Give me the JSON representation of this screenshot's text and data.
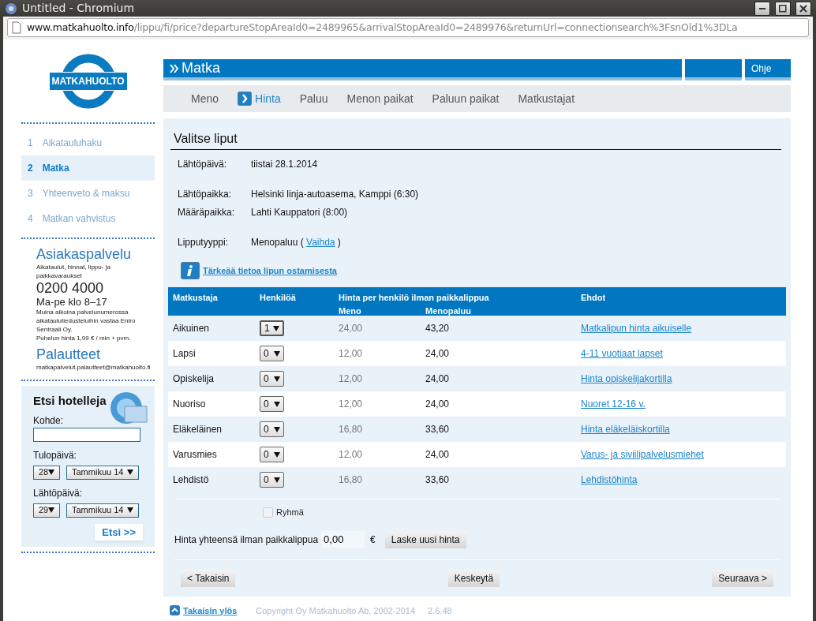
{
  "window": {
    "title": "Untitled - Chromium"
  },
  "address_bar": {
    "host": "www.matkahuolto.info",
    "path": "/lippu/fi/price?departureStopAreaId0=2489965&arrivalStopAreaId0=2489976&returnUrl=connectionsearch%3FsnOld1%3DLa"
  },
  "logo": {
    "text": "MATKAHUOLTO"
  },
  "header": {
    "title": "Matka",
    "help": "Ohje"
  },
  "phase_tabs": [
    {
      "label": "Meno",
      "selected": false
    },
    {
      "label": "Hinta",
      "selected": true
    },
    {
      "label": "Paluu",
      "selected": false
    },
    {
      "label": "Menon paikat",
      "selected": false
    },
    {
      "label": "Paluun paikat",
      "selected": false
    },
    {
      "label": "Matkustajat",
      "selected": false
    }
  ],
  "sidebar": {
    "steps": [
      {
        "number": "1",
        "label": "Aikatauluhaku",
        "selected": false
      },
      {
        "number": "2",
        "label": "Matka",
        "selected": true
      },
      {
        "number": "3",
        "label": "Yhteenveto & maksu",
        "selected": false
      },
      {
        "number": "4",
        "label": "Matkan vahvistus",
        "selected": false
      }
    ],
    "customer_service": {
      "title": "Asiakaspalvelu",
      "subtitle": "Aikataulut, hinnat, lippu- ja paikkavaraukset",
      "phone": "0200 4000",
      "hours": "Ma-pe klo 8–17",
      "note": "Muina aikoina palvelunumerossa aikataulutiedusteluihin vastaa Eniro Sentraali Oy.",
      "price": "Puhelun hinta 1,99 € / min + pvm.",
      "feedback_title": "Palautteet",
      "email": "matkapalvelut.palautteet@matkahuolto.fi"
    },
    "hotel_search": {
      "title": "Etsi hotelleja",
      "destination_label": "Kohde:",
      "arrival_label": "Tulopäivä:",
      "arrival_day": "28",
      "arrival_month": "Tammikuu 14",
      "departure_label": "Lähtöpäivä:",
      "departure_day": "29",
      "departure_month": "Tammikuu 14",
      "button": "Etsi >>"
    }
  },
  "main": {
    "heading": "Valitse liput",
    "detail_groups": [
      [
        {
          "label": "Lähtöpäivä:",
          "value": "tiistai 28.1.2014"
        }
      ],
      [
        {
          "label": "Lähtöpaikka:",
          "value": "Helsinki linja-autoasema, Kamppi (6:30)"
        },
        {
          "label": "Määräpaikka:",
          "value": "Lahti Kauppatori (8:00)"
        }
      ],
      [
        {
          "label": "Lipputyyppi:",
          "value": "Menopaluu (",
          "link": "Vaihda",
          "after": ")"
        }
      ]
    ],
    "info_link": "Tärkeää tietoa lipun ostamisesta",
    "table": {
      "columns": [
        "Matkustaja",
        "Henkilöä",
        "Hinta per henkilö ilman paikkalippua",
        "Ehdot"
      ],
      "subcolumns": [
        "Meno",
        "Menopaluu"
      ],
      "rows": [
        {
          "traveller": "Aikuinen",
          "count": "1",
          "one_way": "24,00",
          "return": "43,20",
          "terms": "Matkalipun hinta aikuiselle"
        },
        {
          "traveller": "Lapsi",
          "count": "0",
          "one_way": "12,00",
          "return": "24,00",
          "terms": "4-11 vuotiaat lapset"
        },
        {
          "traveller": "Opiskelija",
          "count": "0",
          "one_way": "12,00",
          "return": "24,00",
          "terms": "Hinta opiskelijakortilla"
        },
        {
          "traveller": "Nuoriso",
          "count": "0",
          "one_way": "12,00",
          "return": "24,00",
          "terms": "Nuoret 12-16 v."
        },
        {
          "traveller": "Eläkeläinen",
          "count": "0",
          "one_way": "16,80",
          "return": "33,60",
          "terms": "Hinta eläkeläiskortilla"
        },
        {
          "traveller": "Varusmies",
          "count": "0",
          "one_way": "12,00",
          "return": "24,00",
          "terms": "Varus- ja siviilipalvelusmiehet"
        },
        {
          "traveller": "Lehdistö",
          "count": "0",
          "one_way": "16,80",
          "return": "33,60",
          "terms": "Lehdistöhinta"
        }
      ]
    },
    "group_option": {
      "label": "Ryhmä",
      "checked": false,
      "disabled": true
    },
    "total": {
      "label": "Hinta yhteensä ilman paikkalippua",
      "value": "0,00",
      "currency": "€",
      "button": "Laske uusi hinta"
    },
    "nav_buttons": [
      "< Takaisin",
      "Keskeytä",
      "Seuraava >"
    ]
  },
  "footer": {
    "top_link": "Takaisin ylös",
    "copyright": "Copyright Oy Matkahuolto Ab, 2002-2014",
    "version": "2.6.48"
  }
}
